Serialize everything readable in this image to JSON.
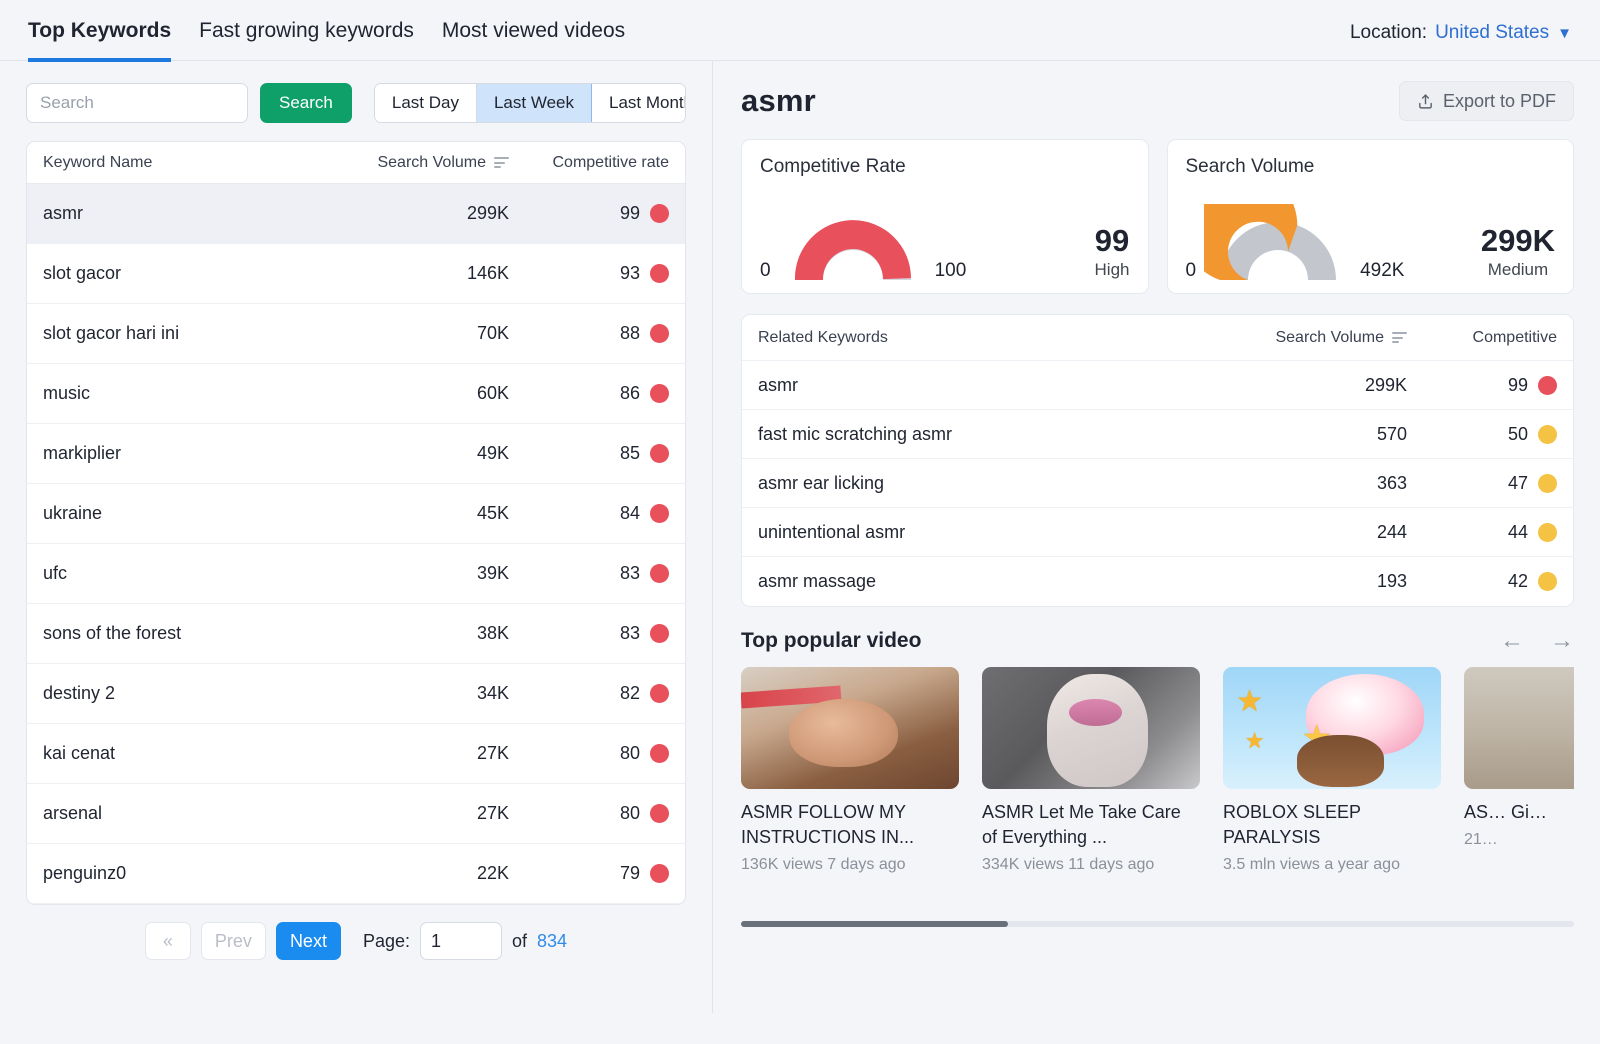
{
  "tabs": [
    {
      "label": "Top Keywords",
      "active": true
    },
    {
      "label": "Fast growing keywords",
      "active": false
    },
    {
      "label": "Most viewed videos",
      "active": false
    }
  ],
  "location": {
    "label": "Location:",
    "value": "United States",
    "caret": "chevron-down-icon"
  },
  "search": {
    "placeholder": "Search",
    "value": "",
    "button_label": "Search"
  },
  "range_filter": {
    "options": [
      "Last Day",
      "Last Week",
      "Last Month"
    ],
    "selected": "Last Week"
  },
  "keyword_table": {
    "columns": [
      "Keyword Name",
      "Search Volume",
      "Competitive rate"
    ],
    "sorted_by": "Search Volume",
    "rows": [
      {
        "name": "asmr",
        "volume": "299K",
        "rate": "99",
        "color": "#e8505b",
        "selected": true
      },
      {
        "name": "slot gacor",
        "volume": "146K",
        "rate": "93",
        "color": "#e8505b",
        "selected": false
      },
      {
        "name": "slot gacor hari ini",
        "volume": "70K",
        "rate": "88",
        "color": "#e8505b",
        "selected": false
      },
      {
        "name": "music",
        "volume": "60K",
        "rate": "86",
        "color": "#e8505b",
        "selected": false
      },
      {
        "name": "markiplier",
        "volume": "49K",
        "rate": "85",
        "color": "#e8505b",
        "selected": false
      },
      {
        "name": "ukraine",
        "volume": "45K",
        "rate": "84",
        "color": "#e8505b",
        "selected": false
      },
      {
        "name": "ufc",
        "volume": "39K",
        "rate": "83",
        "color": "#e8505b",
        "selected": false
      },
      {
        "name": "sons of the forest",
        "volume": "38K",
        "rate": "83",
        "color": "#e8505b",
        "selected": false
      },
      {
        "name": "destiny 2",
        "volume": "34K",
        "rate": "82",
        "color": "#e8505b",
        "selected": false
      },
      {
        "name": "kai cenat",
        "volume": "27K",
        "rate": "80",
        "color": "#e8505b",
        "selected": false
      },
      {
        "name": "arsenal",
        "volume": "27K",
        "rate": "80",
        "color": "#e8505b",
        "selected": false
      },
      {
        "name": "penguinz0",
        "volume": "22K",
        "rate": "79",
        "color": "#e8505b",
        "selected": false
      }
    ]
  },
  "pagination": {
    "first_label": "«",
    "prev_label": "Prev",
    "next_label": "Next",
    "page_label": "Page:",
    "page_value": "1",
    "of_label": "of",
    "total_pages": "834"
  },
  "detail": {
    "title": "asmr",
    "export_label": "Export to PDF",
    "export_icon": "upload-icon"
  },
  "chart_data": [
    {
      "type": "gauge",
      "title": "Competitive Rate",
      "value": 99,
      "min": 0,
      "max": 100,
      "min_label": "0",
      "max_label": "100",
      "value_label": "99",
      "rating": "High",
      "fill_color": "#e8505b",
      "track_color": "#d4d7dd",
      "fill_fraction": 0.99
    },
    {
      "type": "gauge",
      "title": "Search Volume",
      "value": 299000,
      "min": 0,
      "max": 492000,
      "min_label": "0",
      "max_label": "492K",
      "value_label": "299K",
      "rating": "Medium",
      "fill_color": "#f2972f",
      "track_color": "#c3c6cc",
      "fill_fraction": 0.608
    }
  ],
  "related_keywords": {
    "columns": [
      "Related Keywords",
      "Search Volume",
      "Competitive"
    ],
    "sorted_by": "Search Volume",
    "rows": [
      {
        "name": "asmr",
        "volume": "299K",
        "rate": "99",
        "color": "#e8505b"
      },
      {
        "name": "fast mic scratching asmr",
        "volume": "570",
        "rate": "50",
        "color": "#f5c344"
      },
      {
        "name": "asmr ear licking",
        "volume": "363",
        "rate": "47",
        "color": "#f5c344"
      },
      {
        "name": "unintentional asmr",
        "volume": "244",
        "rate": "44",
        "color": "#f5c344"
      },
      {
        "name": "asmr massage",
        "volume": "193",
        "rate": "42",
        "color": "#f5c344"
      }
    ]
  },
  "videos": {
    "section_title": "Top popular video",
    "prev_icon": "arrow-left-icon",
    "next_icon": "arrow-right-icon",
    "items": [
      {
        "title": "ASMR FOLLOW MY INSTRUCTIONS IN...",
        "meta": "136K views 7 days ago",
        "art": "th1"
      },
      {
        "title": "ASMR Let Me Take Care of Everything ...",
        "meta": "334K views 11 days ago",
        "art": "th2"
      },
      {
        "title": "ROBLOX SLEEP PARALYSIS",
        "meta": "3.5 mln views a year ago",
        "art": "th3"
      },
      {
        "title": "AS… Gi…",
        "meta": "21…",
        "art": "th4"
      }
    ]
  }
}
